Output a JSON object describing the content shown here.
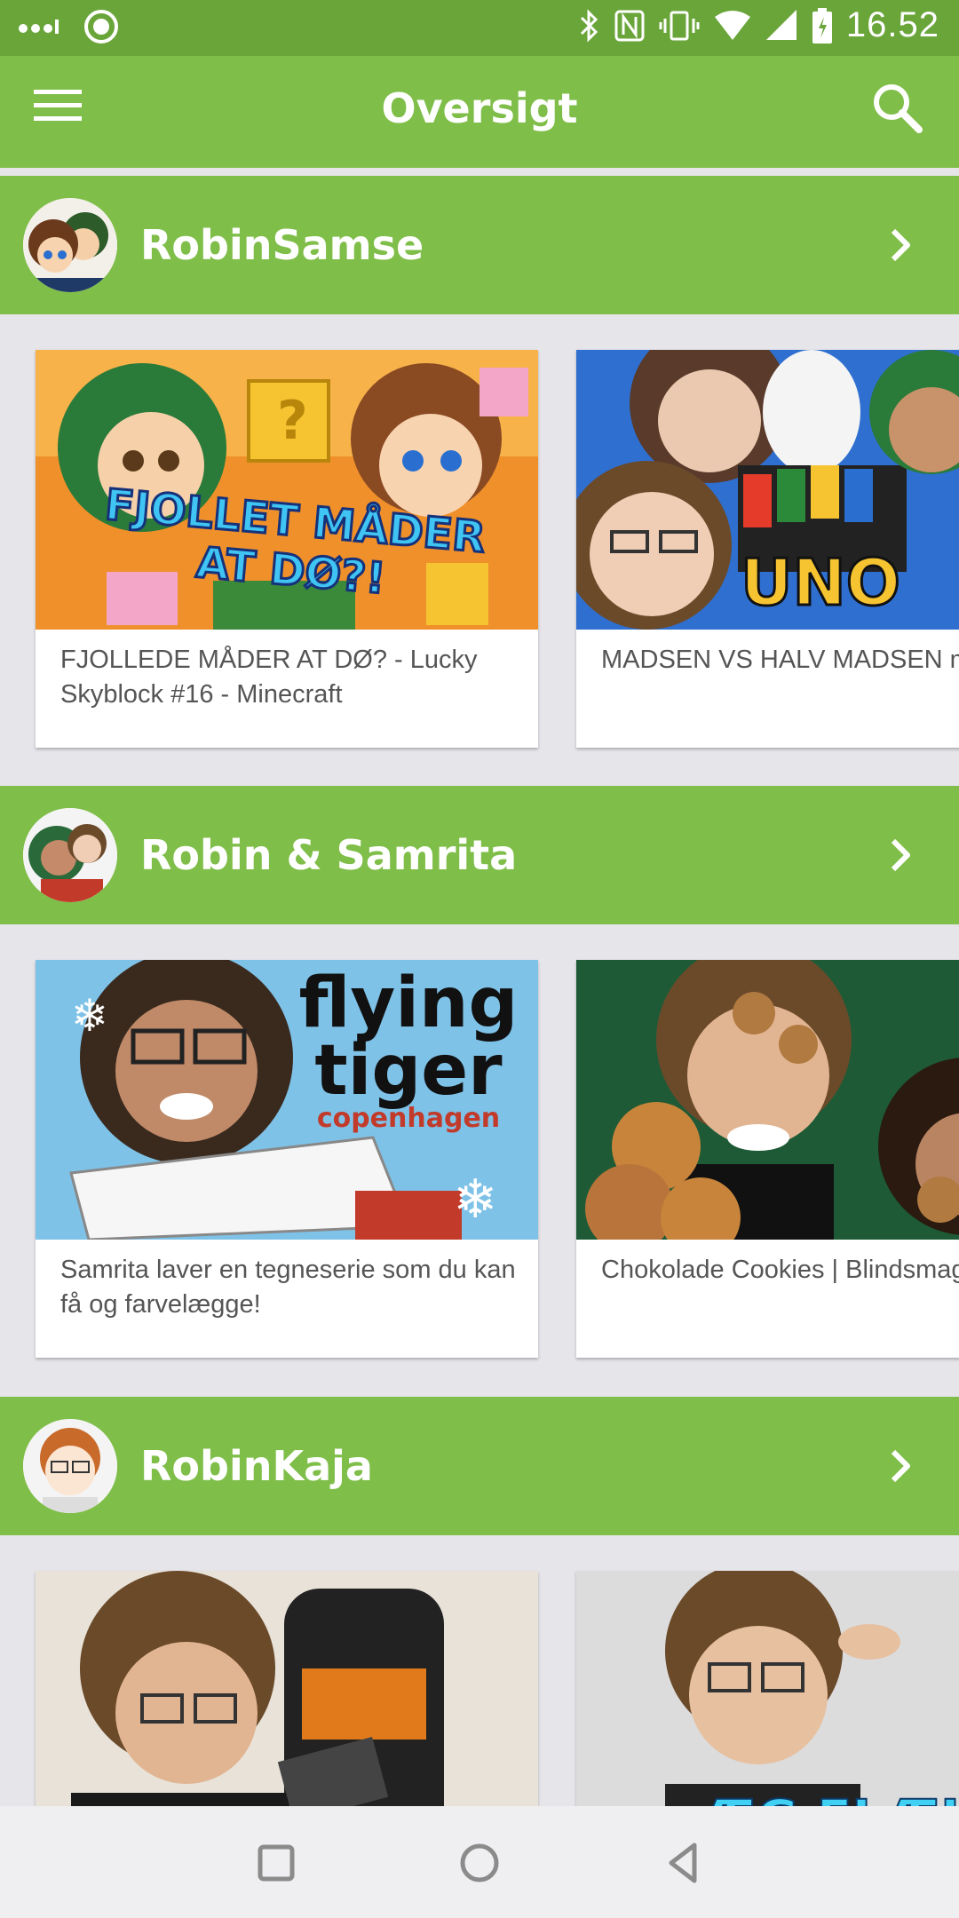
{
  "status_bar": {
    "time": "16.52"
  },
  "app_bar": {
    "title": "Oversigt"
  },
  "channels": [
    {
      "name": "RobinSamse",
      "videos": [
        {
          "title": "FJOLLEDE MÅDER AT DØ? - Lucky Skyblock #16 - Minecraft",
          "thumb_text": [
            "FJOLLET MÅDER",
            "AT DØ?!"
          ]
        },
        {
          "title": "MADSEN VS HALV MADSEN m. Kaja og Allan",
          "thumb_text": [
            "UNO"
          ]
        }
      ]
    },
    {
      "name": "Robin & Samrita",
      "videos": [
        {
          "title": "Samrita laver en tegneserie som du kan få og farvelægge!",
          "thumb_text": [
            "flying",
            "tiger",
            "copenhagen"
          ]
        },
        {
          "title": "Chokolade Cookies | Blindsmagning"
        }
      ]
    },
    {
      "name": "RobinKaja",
      "videos": [
        {
          "title": ""
        },
        {
          "title": "",
          "thumb_text": [
            "ÆG FLÆK"
          ]
        }
      ]
    }
  ],
  "colors": {
    "accent": "#7fbe49",
    "status_bar": "#6aa53a",
    "background": "#e6e5ea"
  },
  "icons": [
    "menu-icon",
    "search-icon",
    "chevron-right-icon",
    "nav-recents-icon",
    "nav-home-icon",
    "nav-back-icon"
  ]
}
